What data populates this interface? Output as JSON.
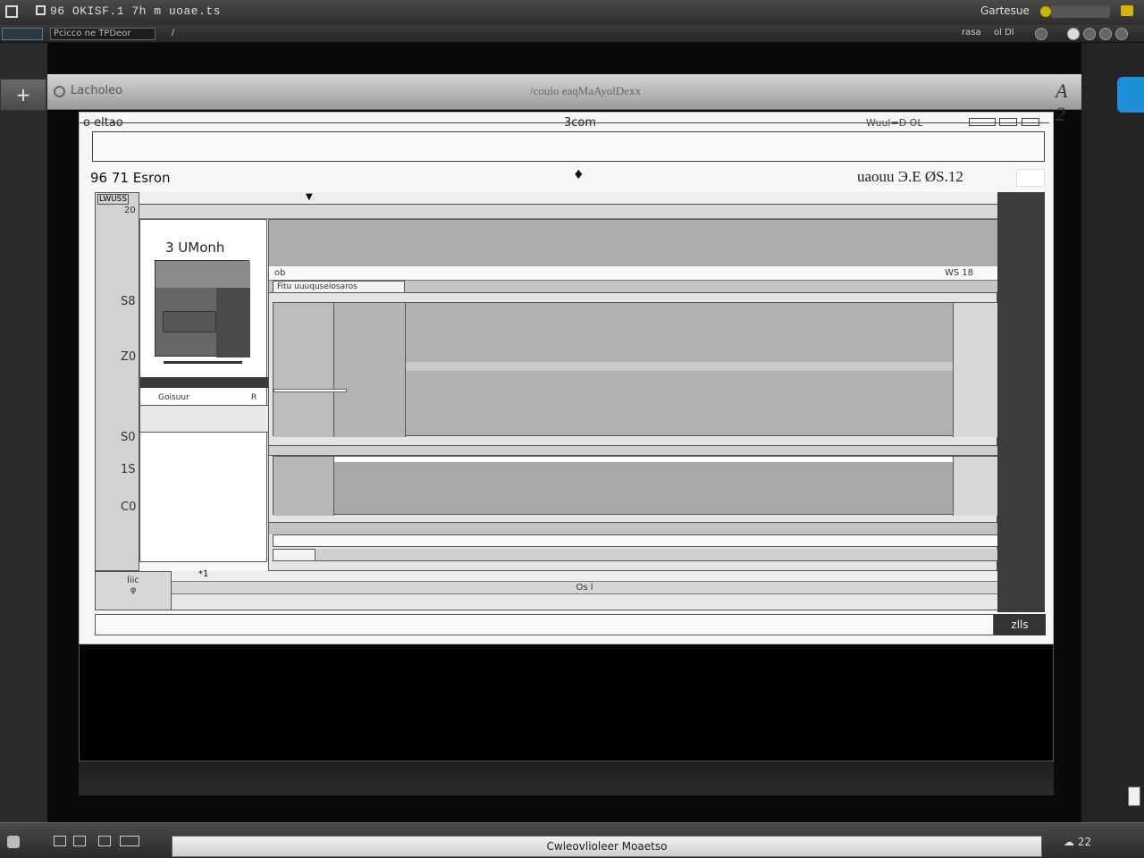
{
  "window": {
    "title": "96 OKISF.1 7h m uoae.ts",
    "user_label": "Gartesue"
  },
  "toolbar": {
    "address": "Pcicco ne TPDeor",
    "address_sep": "/",
    "right_label": "rasa",
    "right_label2": "ol Dl"
  },
  "app": {
    "back_symbol": "+",
    "brand": "Lacholeo",
    "title": "/coulo eaqMaAyolDexx",
    "logo": "A 2"
  },
  "doc": {
    "header_left": "o eltao",
    "header_mid": "3com",
    "header_right": "Wuul=D OL",
    "section_title": "96 71 Esron",
    "section_mid_icon": "♦",
    "section_right": "uaouu  Э.Е  ØS.12",
    "command_button": "zlls"
  },
  "workspace": {
    "gutter_top_label": "LWUSS",
    "gutter_numbers": [
      "20",
      "S8",
      "Z0",
      "S0",
      "1S",
      "C0"
    ],
    "thumb_label": "3  UMonh",
    "row1_label": "Goisuur",
    "row1_right": "R",
    "main_header_left": "ob",
    "main_header_right": "WS 18",
    "tab_label": "Fitu      uuuquseiosaros",
    "bottom_box_lines": [
      "liic",
      "φ"
    ],
    "bottom_strip_label": "Os l",
    "bottom_marker": "*1"
  },
  "taskbar": {
    "status_text": "Cwleovlioleer Moaetso",
    "tray_text": "☁ 22"
  }
}
